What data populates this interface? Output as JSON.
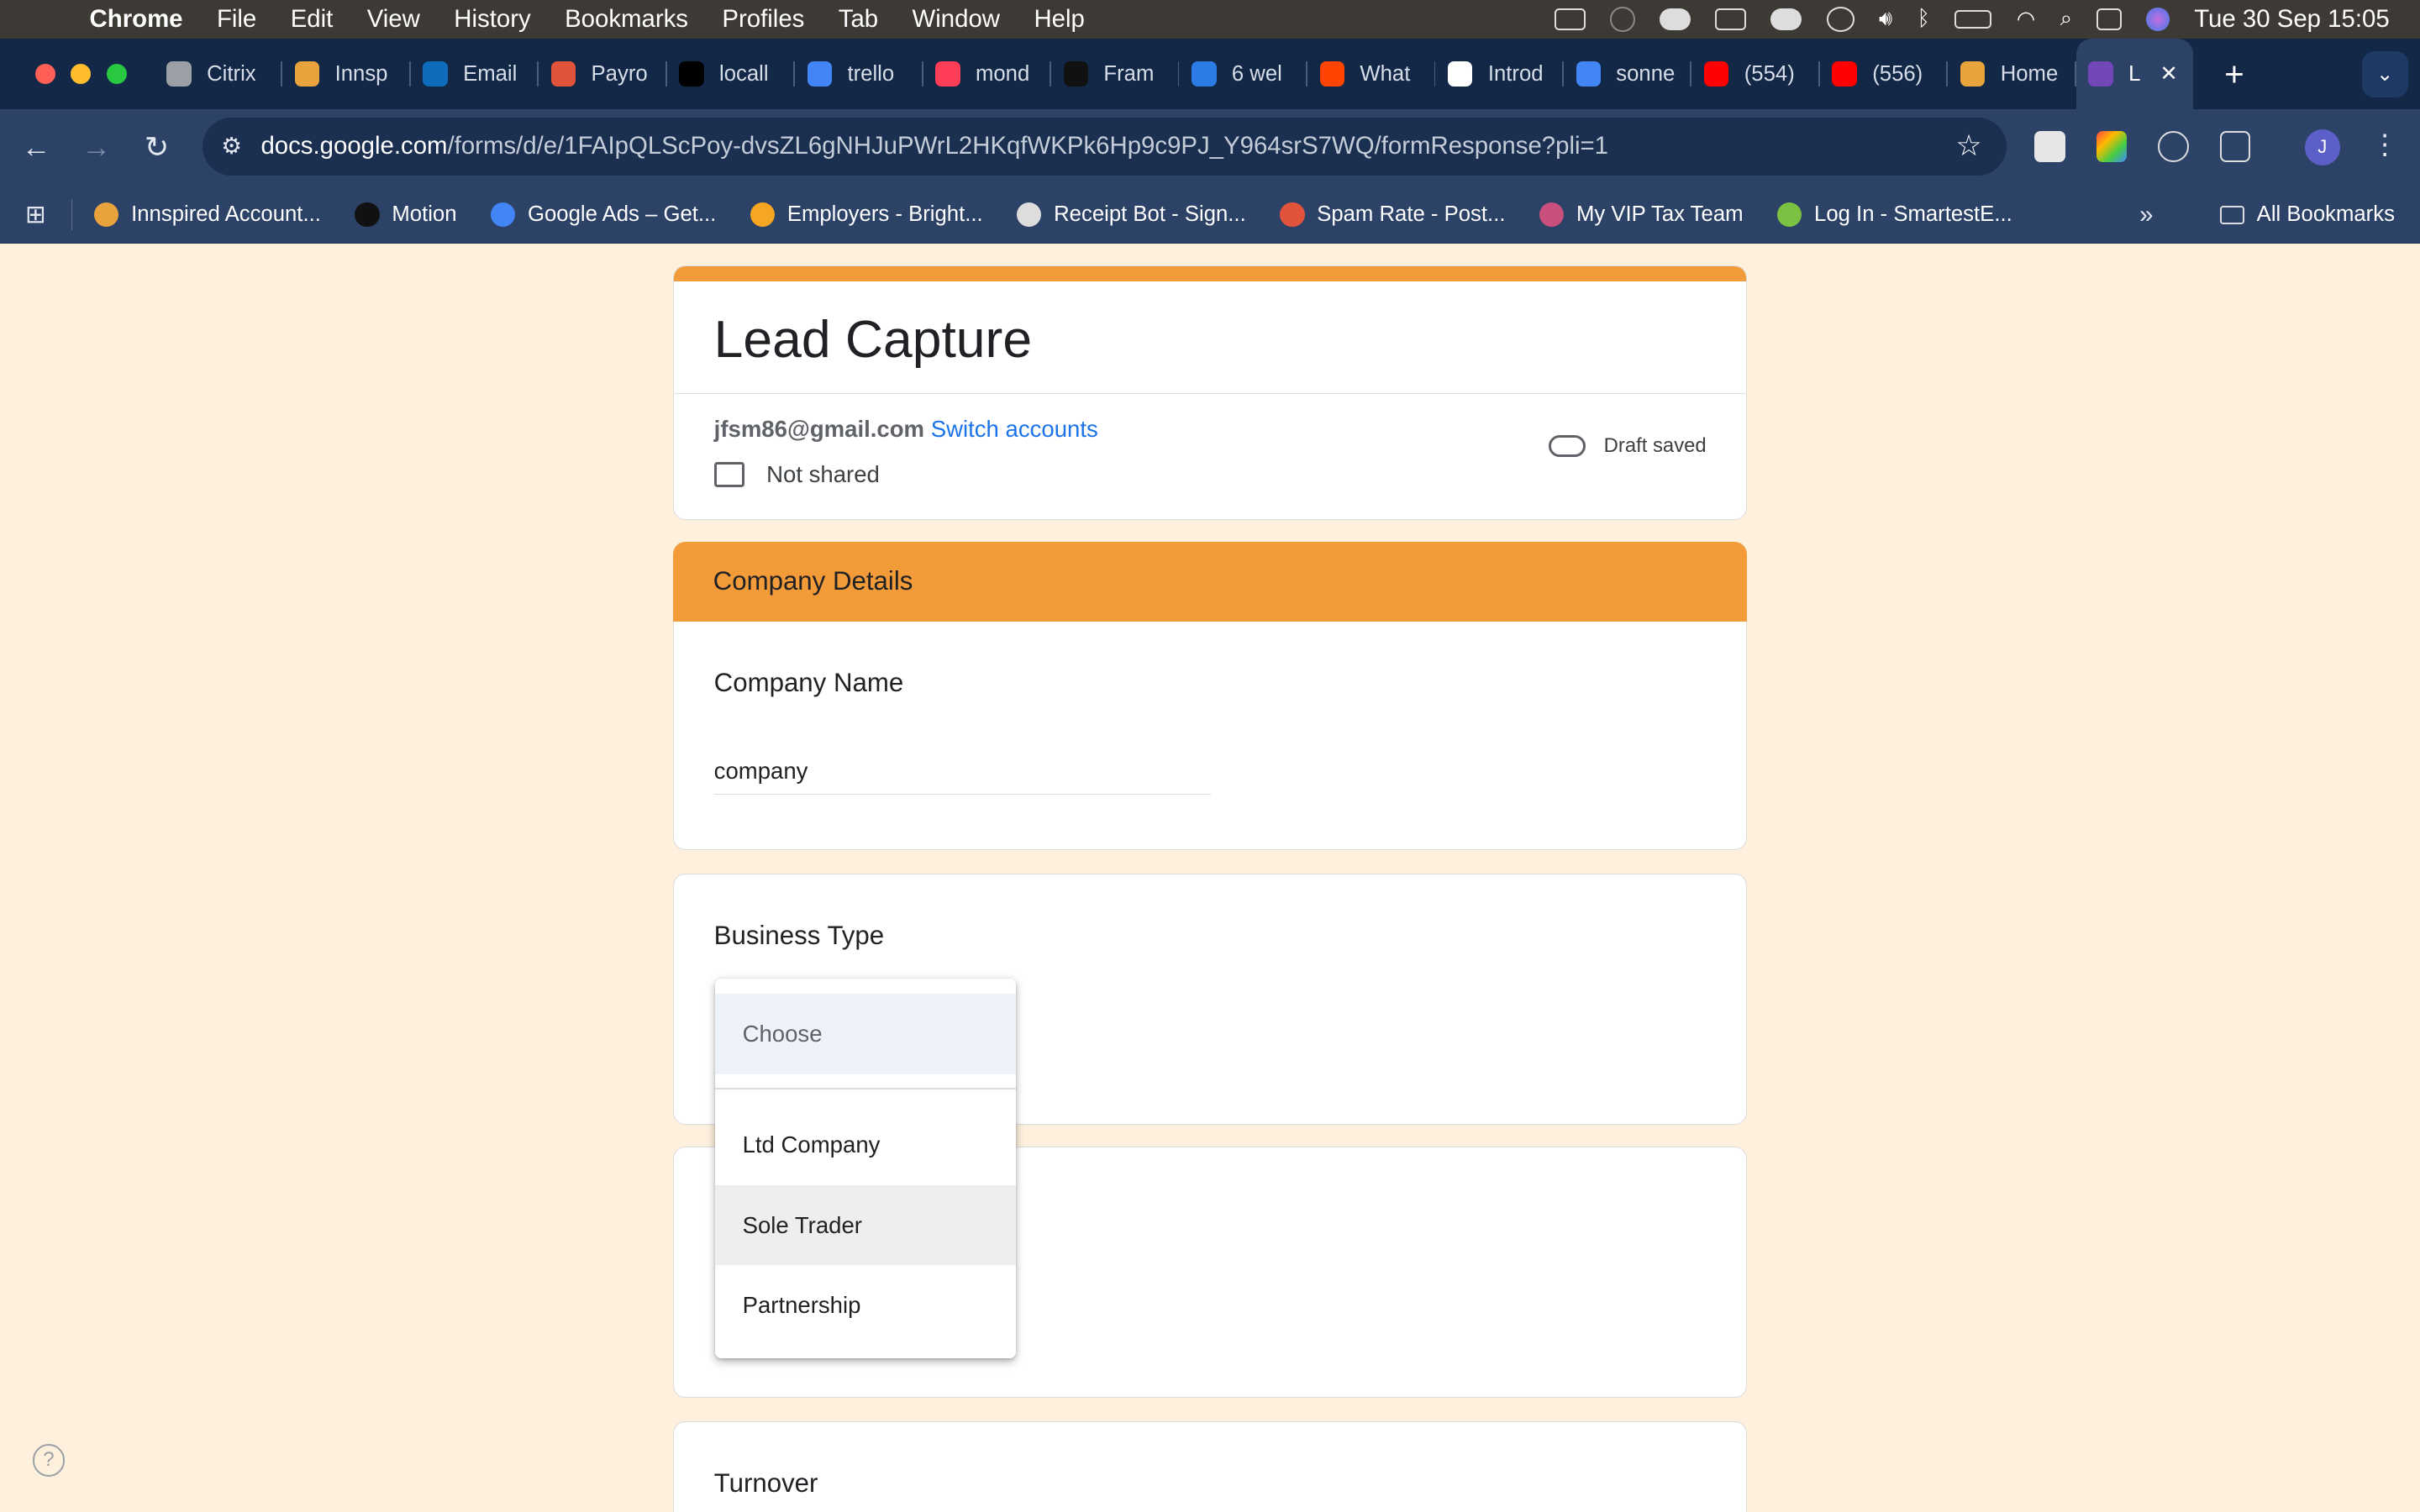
{
  "menubar": {
    "app": "Chrome",
    "items": [
      "File",
      "Edit",
      "View",
      "History",
      "Bookmarks",
      "Profiles",
      "Tab",
      "Window",
      "Help"
    ],
    "datetime": "Tue 30 Sep  15:05"
  },
  "tabs": [
    {
      "label": "Citrix",
      "color": "#9aa0a6"
    },
    {
      "label": "Innsp",
      "color": "#e8a33c"
    },
    {
      "label": "Email",
      "color": "#0f6cbd"
    },
    {
      "label": "Payro",
      "color": "#e2533c"
    },
    {
      "label": "locall",
      "color": "#000000"
    },
    {
      "label": "trello",
      "color": "#4285f4"
    },
    {
      "label": "mond",
      "color": "#ff3d57"
    },
    {
      "label": "Fram",
      "color": "#111111"
    },
    {
      "label": "6 wel",
      "color": "#2d7be5"
    },
    {
      "label": "What",
      "color": "#ff4500"
    },
    {
      "label": "Introd",
      "color": "#ffffff"
    },
    {
      "label": "sonne",
      "color": "#4285f4"
    },
    {
      "label": "(554)",
      "color": "#ff0000"
    },
    {
      "label": "(556)",
      "color": "#ff0000"
    },
    {
      "label": "Home",
      "color": "#e8a33c"
    }
  ],
  "active_tab": {
    "label": "L",
    "close": "✕",
    "color": "#7248b9"
  },
  "new_tab": "+",
  "tab_menu": "⌄",
  "address": {
    "host": "docs.google.com",
    "path": "/forms/d/e/1FAIpQLScPoy-dvsZL6gNHJuPWrL2HKqfWKPk6Hp9c9PJ_Y964srS7WQ/formResponse?pli=1"
  },
  "avatar_letter": "J",
  "bookmarks": [
    {
      "label": "Innspired Account...",
      "color": "#e8a33c"
    },
    {
      "label": "Motion",
      "color": "#111111"
    },
    {
      "label": "Google Ads – Get...",
      "color": "#4285f4"
    },
    {
      "label": "Employers - Bright...",
      "color": "#f5a623"
    },
    {
      "label": "Receipt Bot - Sign...",
      "color": "#dddddd"
    },
    {
      "label": "Spam Rate - Post...",
      "color": "#e2533c"
    },
    {
      "label": "My VIP Tax Team",
      "color": "#c94f7c"
    },
    {
      "label": "Log In - SmartestE...",
      "color": "#7cc242"
    }
  ],
  "bookmarks_more": "»",
  "all_bookmarks": "All Bookmarks",
  "form": {
    "title": "Lead Capture",
    "email": "jfsm86@gmail.com",
    "switch_accounts": "Switch accounts",
    "not_shared": "Not shared",
    "draft_saved": "Draft saved",
    "section_title": "Company Details",
    "questions": [
      {
        "label": "Company Name",
        "answer": "company"
      },
      {
        "label": "Business Type"
      },
      {
        "label": ""
      },
      {
        "label": "Turnover"
      }
    ],
    "dropdown": {
      "placeholder": "Choose",
      "options": [
        "Ltd Company",
        "Sole Trader",
        "Partnership"
      ],
      "hovered": "Sole Trader"
    }
  },
  "colors": {
    "accent": "#f29b38",
    "page_bg": "#fdf0dd",
    "link": "#1a73e8"
  }
}
